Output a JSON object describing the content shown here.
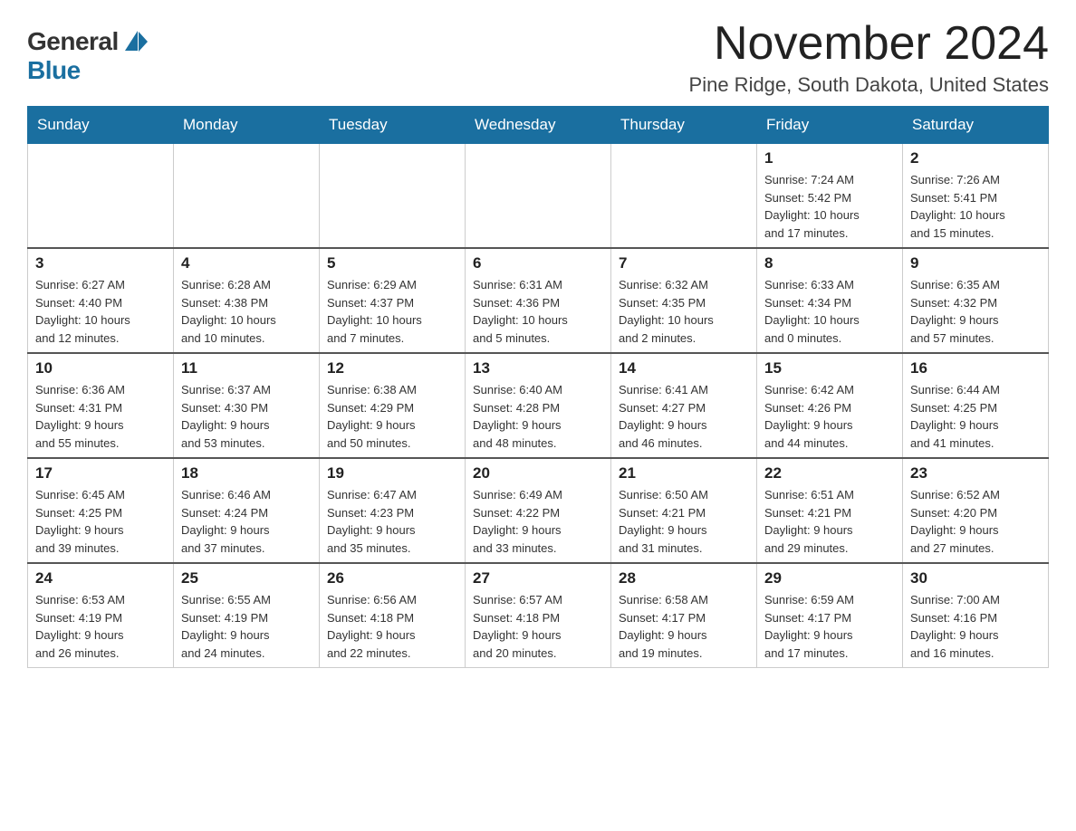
{
  "logo": {
    "general": "General",
    "blue": "Blue"
  },
  "title": "November 2024",
  "location": "Pine Ridge, South Dakota, United States",
  "weekdays": [
    "Sunday",
    "Monday",
    "Tuesday",
    "Wednesday",
    "Thursday",
    "Friday",
    "Saturday"
  ],
  "weeks": [
    [
      {
        "day": "",
        "info": ""
      },
      {
        "day": "",
        "info": ""
      },
      {
        "day": "",
        "info": ""
      },
      {
        "day": "",
        "info": ""
      },
      {
        "day": "",
        "info": ""
      },
      {
        "day": "1",
        "info": "Sunrise: 7:24 AM\nSunset: 5:42 PM\nDaylight: 10 hours\nand 17 minutes."
      },
      {
        "day": "2",
        "info": "Sunrise: 7:26 AM\nSunset: 5:41 PM\nDaylight: 10 hours\nand 15 minutes."
      }
    ],
    [
      {
        "day": "3",
        "info": "Sunrise: 6:27 AM\nSunset: 4:40 PM\nDaylight: 10 hours\nand 12 minutes."
      },
      {
        "day": "4",
        "info": "Sunrise: 6:28 AM\nSunset: 4:38 PM\nDaylight: 10 hours\nand 10 minutes."
      },
      {
        "day": "5",
        "info": "Sunrise: 6:29 AM\nSunset: 4:37 PM\nDaylight: 10 hours\nand 7 minutes."
      },
      {
        "day": "6",
        "info": "Sunrise: 6:31 AM\nSunset: 4:36 PM\nDaylight: 10 hours\nand 5 minutes."
      },
      {
        "day": "7",
        "info": "Sunrise: 6:32 AM\nSunset: 4:35 PM\nDaylight: 10 hours\nand 2 minutes."
      },
      {
        "day": "8",
        "info": "Sunrise: 6:33 AM\nSunset: 4:34 PM\nDaylight: 10 hours\nand 0 minutes."
      },
      {
        "day": "9",
        "info": "Sunrise: 6:35 AM\nSunset: 4:32 PM\nDaylight: 9 hours\nand 57 minutes."
      }
    ],
    [
      {
        "day": "10",
        "info": "Sunrise: 6:36 AM\nSunset: 4:31 PM\nDaylight: 9 hours\nand 55 minutes."
      },
      {
        "day": "11",
        "info": "Sunrise: 6:37 AM\nSunset: 4:30 PM\nDaylight: 9 hours\nand 53 minutes."
      },
      {
        "day": "12",
        "info": "Sunrise: 6:38 AM\nSunset: 4:29 PM\nDaylight: 9 hours\nand 50 minutes."
      },
      {
        "day": "13",
        "info": "Sunrise: 6:40 AM\nSunset: 4:28 PM\nDaylight: 9 hours\nand 48 minutes."
      },
      {
        "day": "14",
        "info": "Sunrise: 6:41 AM\nSunset: 4:27 PM\nDaylight: 9 hours\nand 46 minutes."
      },
      {
        "day": "15",
        "info": "Sunrise: 6:42 AM\nSunset: 4:26 PM\nDaylight: 9 hours\nand 44 minutes."
      },
      {
        "day": "16",
        "info": "Sunrise: 6:44 AM\nSunset: 4:25 PM\nDaylight: 9 hours\nand 41 minutes."
      }
    ],
    [
      {
        "day": "17",
        "info": "Sunrise: 6:45 AM\nSunset: 4:25 PM\nDaylight: 9 hours\nand 39 minutes."
      },
      {
        "day": "18",
        "info": "Sunrise: 6:46 AM\nSunset: 4:24 PM\nDaylight: 9 hours\nand 37 minutes."
      },
      {
        "day": "19",
        "info": "Sunrise: 6:47 AM\nSunset: 4:23 PM\nDaylight: 9 hours\nand 35 minutes."
      },
      {
        "day": "20",
        "info": "Sunrise: 6:49 AM\nSunset: 4:22 PM\nDaylight: 9 hours\nand 33 minutes."
      },
      {
        "day": "21",
        "info": "Sunrise: 6:50 AM\nSunset: 4:21 PM\nDaylight: 9 hours\nand 31 minutes."
      },
      {
        "day": "22",
        "info": "Sunrise: 6:51 AM\nSunset: 4:21 PM\nDaylight: 9 hours\nand 29 minutes."
      },
      {
        "day": "23",
        "info": "Sunrise: 6:52 AM\nSunset: 4:20 PM\nDaylight: 9 hours\nand 27 minutes."
      }
    ],
    [
      {
        "day": "24",
        "info": "Sunrise: 6:53 AM\nSunset: 4:19 PM\nDaylight: 9 hours\nand 26 minutes."
      },
      {
        "day": "25",
        "info": "Sunrise: 6:55 AM\nSunset: 4:19 PM\nDaylight: 9 hours\nand 24 minutes."
      },
      {
        "day": "26",
        "info": "Sunrise: 6:56 AM\nSunset: 4:18 PM\nDaylight: 9 hours\nand 22 minutes."
      },
      {
        "day": "27",
        "info": "Sunrise: 6:57 AM\nSunset: 4:18 PM\nDaylight: 9 hours\nand 20 minutes."
      },
      {
        "day": "28",
        "info": "Sunrise: 6:58 AM\nSunset: 4:17 PM\nDaylight: 9 hours\nand 19 minutes."
      },
      {
        "day": "29",
        "info": "Sunrise: 6:59 AM\nSunset: 4:17 PM\nDaylight: 9 hours\nand 17 minutes."
      },
      {
        "day": "30",
        "info": "Sunrise: 7:00 AM\nSunset: 4:16 PM\nDaylight: 9 hours\nand 16 minutes."
      }
    ]
  ]
}
